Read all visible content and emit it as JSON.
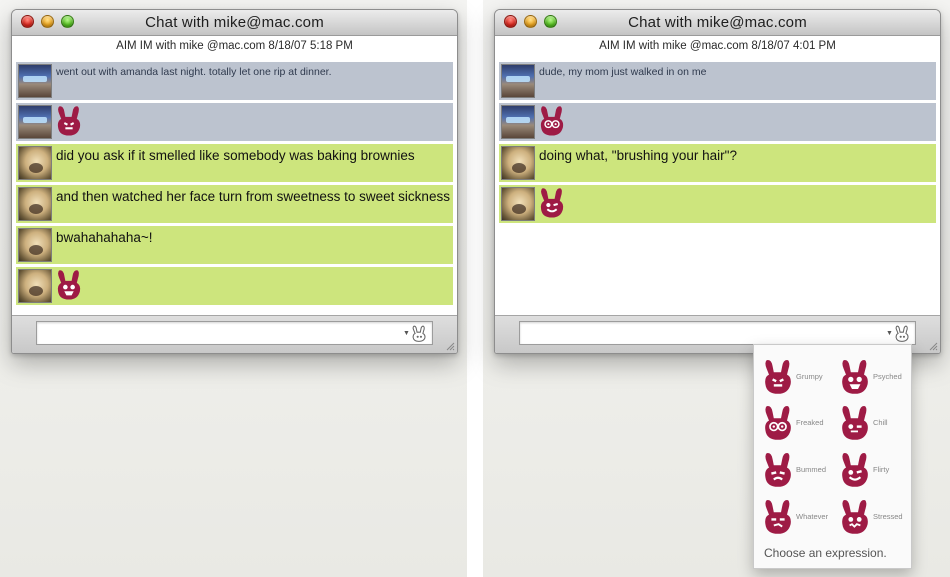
{
  "left_window": {
    "title": "Chat with mike@mac.com",
    "header": "AIM IM with mike @mac.com   8/18/07  5:18 PM",
    "messages": [
      {
        "sender": "mike",
        "avatar": "mike-avatar",
        "text": "went out with amanda last night. totally let one rip at dinner."
      },
      {
        "sender": "mike",
        "avatar": "mike-avatar",
        "emote": "grumpy-icon"
      },
      {
        "sender": "me",
        "avatar": "dog-avatar",
        "text": "did you ask if it smelled like somebody was baking brownies"
      },
      {
        "sender": "me",
        "avatar": "dog-avatar",
        "text": "and then watched her face turn from sweetness to sweet sickness"
      },
      {
        "sender": "me",
        "avatar": "dog-avatar",
        "text": "bwahahahaha~!"
      },
      {
        "sender": "me",
        "avatar": "dog-avatar",
        "emote": "psyched-icon"
      }
    ],
    "input_value": ""
  },
  "right_window": {
    "title": "Chat with mike@mac.com",
    "header": "AIM IM with mike @mac.com   8/18/07  4:01 PM",
    "messages": [
      {
        "sender": "mike",
        "avatar": "mike-avatar",
        "text": "dude, my mom just walked in on me"
      },
      {
        "sender": "mike",
        "avatar": "mike-avatar",
        "emote": "freaked-icon"
      },
      {
        "sender": "me",
        "avatar": "dog-avatar",
        "text": "doing what, \"brushing your hair\"?"
      },
      {
        "sender": "me",
        "avatar": "dog-avatar",
        "emote": "flirty-icon"
      }
    ],
    "input_value": ""
  },
  "expression_popup": {
    "items": [
      {
        "label": "Grumpy",
        "icon": "grumpy-icon"
      },
      {
        "label": "Psyched",
        "icon": "psyched-icon"
      },
      {
        "label": "Freaked",
        "icon": "freaked-icon"
      },
      {
        "label": "Chill",
        "icon": "chill-icon"
      },
      {
        "label": "Bummed",
        "icon": "bummed-icon"
      },
      {
        "label": "Flirty",
        "icon": "flirty-icon"
      },
      {
        "label": "Whatever",
        "icon": "whatever-icon"
      },
      {
        "label": "Stressed",
        "icon": "stressed-icon"
      }
    ],
    "hint": "Choose an expression."
  },
  "colors": {
    "mike_bubble": "#bcc3cf",
    "me_bubble": "#cde57d",
    "emote": "#9e1b45"
  }
}
